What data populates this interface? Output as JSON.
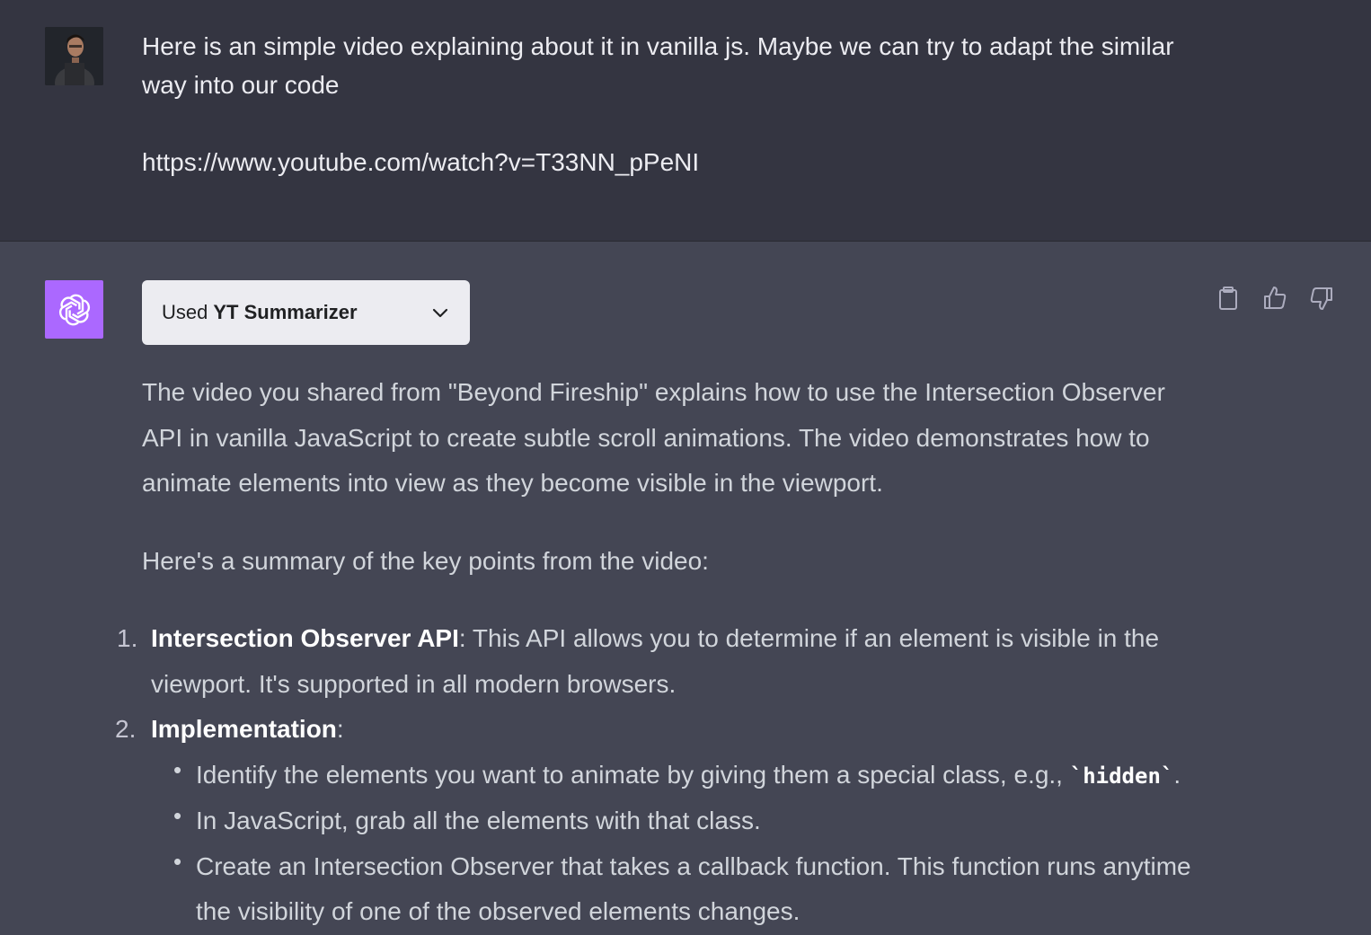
{
  "user_message": {
    "line1": "Here is an simple video explaining about it in vanilla js. Maybe we can try to adapt the similar way into our code",
    "link": "https://www.youtube.com/watch?v=T33NN_pPeNI"
  },
  "plugin": {
    "prefix": "Used",
    "name": "YT Summarizer"
  },
  "actions": [
    "clipboard-icon",
    "thumbs-up-icon",
    "thumbs-down-icon"
  ],
  "answer": {
    "intro": "The video you shared from \"Beyond Fireship\" explains how to use the Intersection Observer API in vanilla JavaScript to create subtle scroll animations. The video demonstrates how to animate elements into view as they become visible in the viewport.",
    "summary_heading": "Here's a summary of the key points from the video:",
    "points": [
      {
        "num": "1.",
        "title": "Intersection Observer API",
        "text": ": This API allows you to determine if an element is visible in the viewport. It's supported in all modern browsers."
      },
      {
        "num": "2.",
        "title": "Implementation",
        "text": ":"
      }
    ],
    "bullets": [
      {
        "before": "Identify the elements you want to animate by giving them a special class, e.g., ",
        "code": "`hidden`",
        "after": "."
      },
      {
        "before": "In JavaScript, grab all the elements with that class.",
        "code": "",
        "after": ""
      },
      {
        "before": "Create an Intersection Observer that takes a callback function. This function runs anytime the visibility of one of the observed elements changes.",
        "code": "",
        "after": ""
      }
    ]
  },
  "colors": {
    "user_bg": "#343541",
    "assistant_bg": "#444654",
    "gpt_avatar": "#ab68ff",
    "plugin_bg": "#ececf1"
  }
}
